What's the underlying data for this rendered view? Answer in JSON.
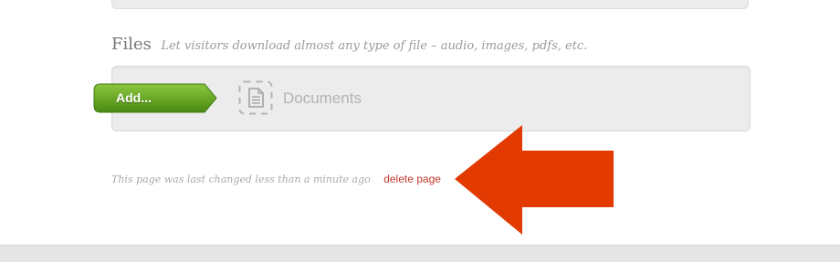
{
  "files_section": {
    "title": "Files",
    "description": "Let visitors download almost any type of file – audio, images, pdfs, etc.",
    "add_button_label": "Add...",
    "documents_label": "Documents"
  },
  "footer": {
    "last_changed": "This page was last changed less than a minute ago",
    "delete_link": "delete page"
  },
  "icons": {
    "documents": "document-icon",
    "annotation": "arrow-left-icon"
  },
  "colors": {
    "add_button_green": "#5a9a1e",
    "delete_link": "#c0392b",
    "annotation_arrow": "#e23a00"
  }
}
